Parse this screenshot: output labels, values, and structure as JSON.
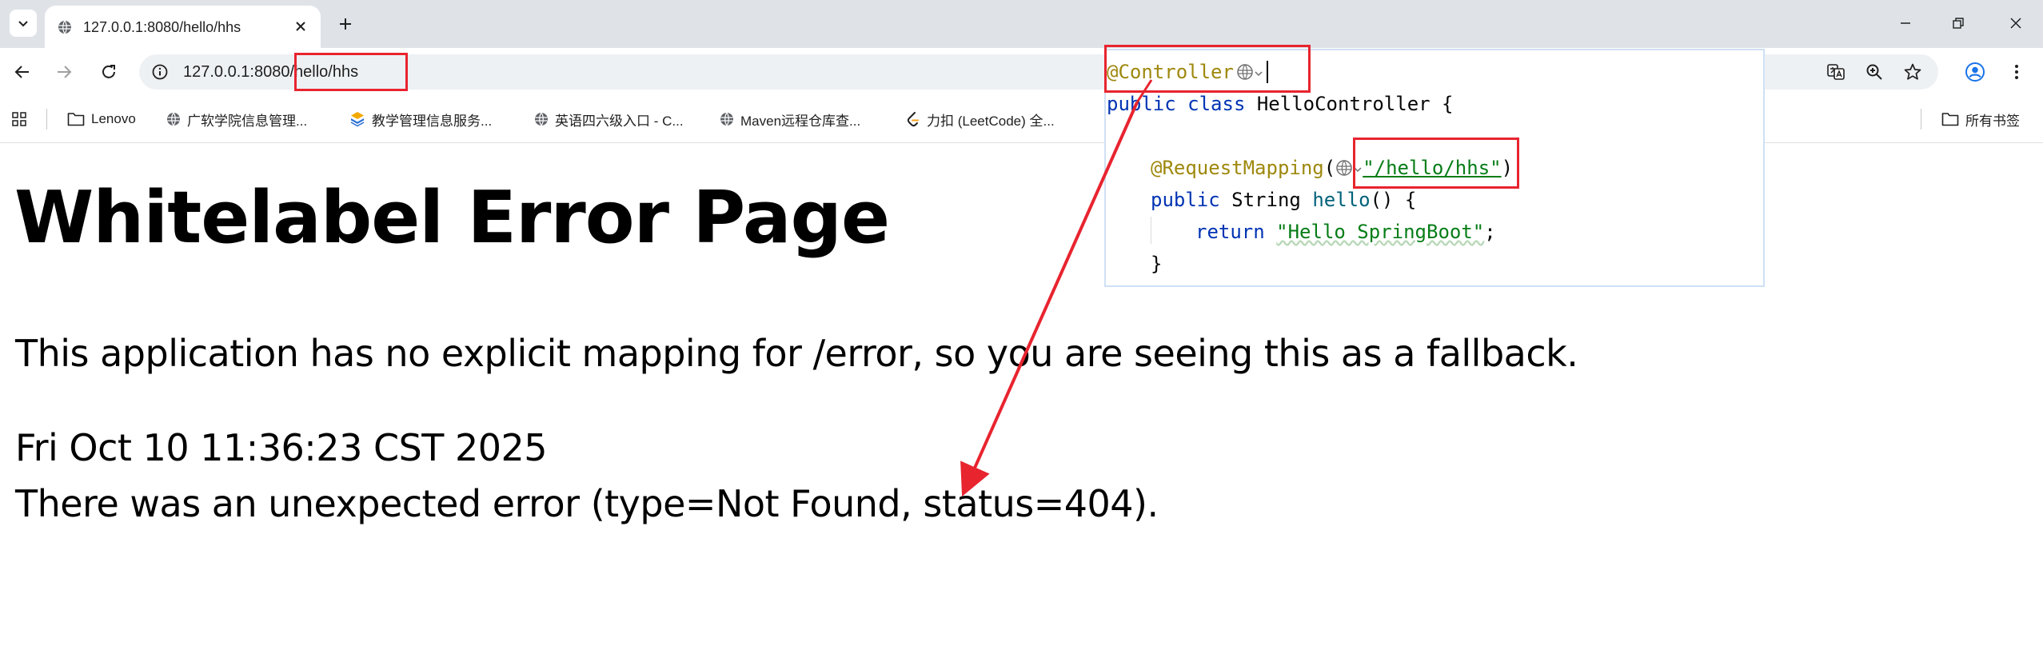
{
  "browser": {
    "tab_title": "127.0.0.1:8080/hello/hhs",
    "url_host": "127.0.0.1:8080",
    "url_path": "/hello/hhs",
    "bookmarks": [
      {
        "label": "Lenovo",
        "icon": "folder-icon"
      },
      {
        "label": "广软学院信息管理...",
        "icon": "site-icon"
      },
      {
        "label": "教学管理信息服务...",
        "icon": "site-icon"
      },
      {
        "label": "英语四六级入口 - C...",
        "icon": "site-icon"
      },
      {
        "label": "Maven远程仓库查...",
        "icon": "site-icon"
      },
      {
        "label": "力扣 (LeetCode) 全...",
        "icon": "site-icon"
      }
    ],
    "all_bookmarks_label": "所有书签"
  },
  "page": {
    "title": "Whitelabel Error Page",
    "message": "This application has no explicit mapping for /error, so you are seeing this as a fallback.",
    "date": "Fri Oct 10 11:36:23 CST 2025",
    "error": "There was an unexpected error (type=Not Found, status=404)."
  },
  "code": {
    "line1_annotation": "@Controller",
    "line2_kw1": "public",
    "line2_kw2": "class",
    "line2_rest": "HelloController {",
    "line4_annotation": "@RequestMapping",
    "line4_open": "(",
    "line4_string": "\"/hello/hhs\"",
    "line4_close": ")",
    "line5_kw": "public",
    "line5_type": "String",
    "line5_fn": "hello",
    "line5_rest": "() {",
    "line6_kw": "return",
    "line6_string": "\"Hello SpringBoot\"",
    "line6_end": ";",
    "line7": "}"
  },
  "colors": {
    "annotation_box": "#e8242f",
    "arrow": "#e8242f"
  }
}
